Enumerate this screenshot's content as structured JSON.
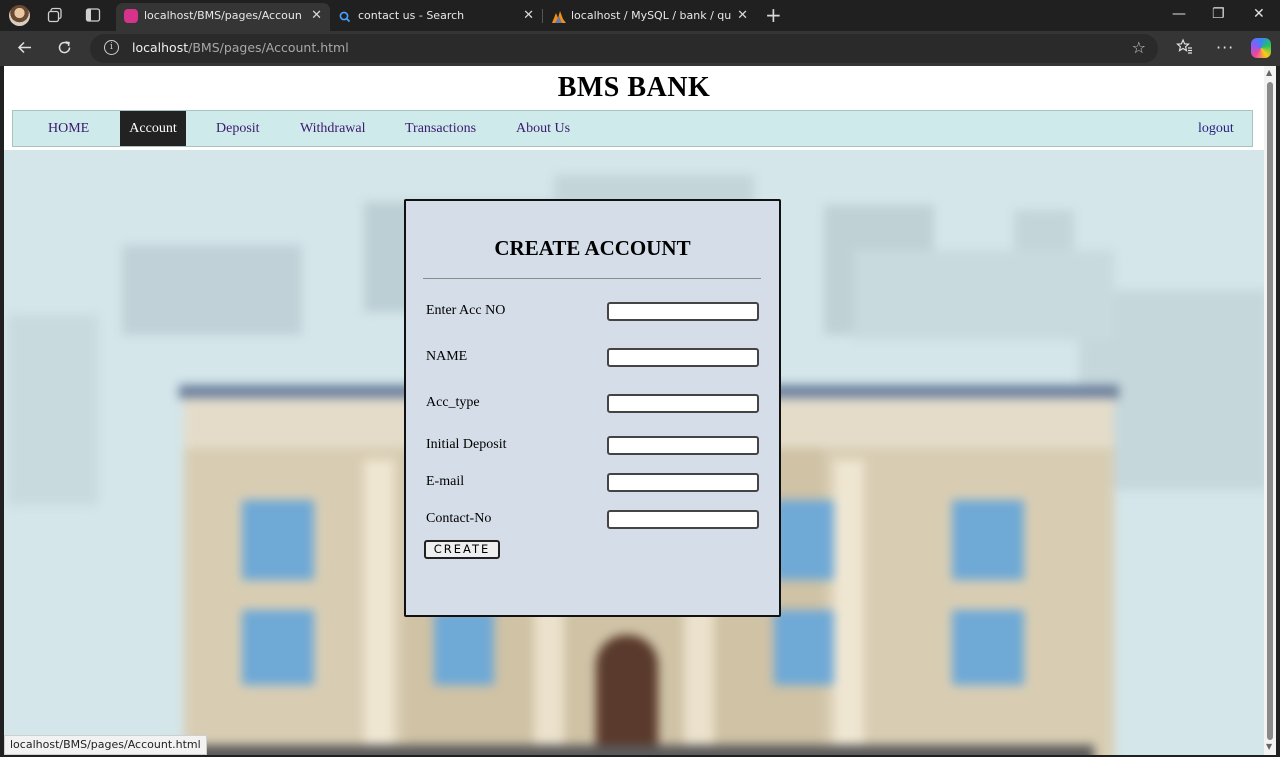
{
  "browser": {
    "tabs": [
      {
        "title": "localhost/BMS/pages/Account.html",
        "active": true,
        "icon": "localhost-favicon"
      },
      {
        "title": "contact us - Search",
        "active": false,
        "icon": "search-icon"
      },
      {
        "title": "localhost / MySQL / bank / queries",
        "active": false,
        "icon": "phpmyadmin-icon"
      }
    ],
    "url_host": "localhost",
    "url_path": "/BMS/pages/Account.html",
    "status_url": "localhost/BMS/pages/Account.html"
  },
  "site": {
    "title": "BMS BANK",
    "nav": [
      {
        "label": "HOME",
        "active": false
      },
      {
        "label": "Account",
        "active": true
      },
      {
        "label": "Deposit",
        "active": false
      },
      {
        "label": "Withdrawal",
        "active": false
      },
      {
        "label": "Transactions",
        "active": false
      },
      {
        "label": "About Us",
        "active": false
      }
    ],
    "logout_label": "logout"
  },
  "form": {
    "title": "CREATE ACCOUNT",
    "fields": [
      {
        "label": "Enter Acc  NO",
        "value": ""
      },
      {
        "label": "NAME",
        "value": ""
      },
      {
        "label": "Acc_type",
        "value": ""
      },
      {
        "label": "Initial Deposit",
        "value": ""
      },
      {
        "label": "E-mail",
        "value": ""
      },
      {
        "label": "Contact-No",
        "value": ""
      }
    ],
    "submit_label": "CREATE"
  },
  "colors": {
    "nav_bg": "#cfeaea",
    "nav_active_bg": "#222222",
    "card_bg": "#d5dde8"
  }
}
